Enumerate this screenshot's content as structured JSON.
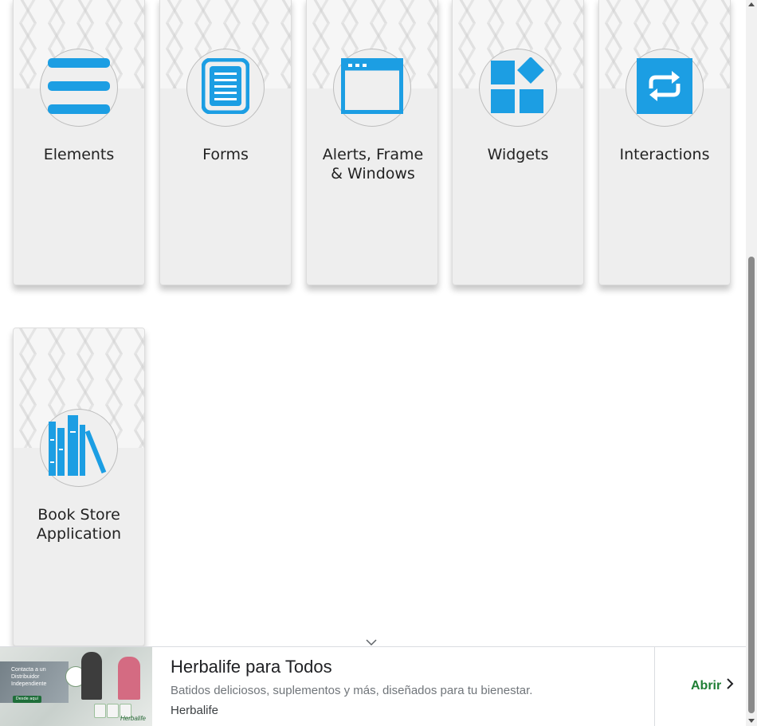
{
  "cards": [
    {
      "label": "Elements",
      "icon": "list-icon"
    },
    {
      "label": "Forms",
      "icon": "document-icon"
    },
    {
      "label": "Alerts, Frame & Windows",
      "icon": "browser-window-icon"
    },
    {
      "label": "Widgets",
      "icon": "widgets-icon"
    },
    {
      "label": "Interactions",
      "icon": "repeat-icon"
    },
    {
      "label": "Book Store Application",
      "icon": "books-icon"
    }
  ],
  "accent_color": "#1c9ee3",
  "ad": {
    "title": "Herbalife para Todos",
    "description": "Batidos deliciosos, suplementos y más, diseñados para tu bienestar.",
    "advertiser": "Herbalife",
    "cta": "Abrir",
    "thumbnail": {
      "headline": "Contacta a un Distribuidor Independiente",
      "button": "Desde aquí",
      "brand": "Herbalife"
    }
  }
}
